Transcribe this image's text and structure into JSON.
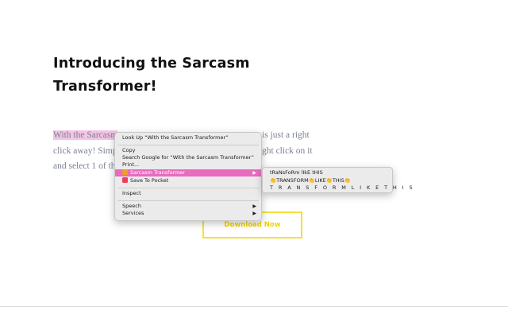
{
  "page": {
    "title_line1": "Introducing the Sarcasm",
    "title_line2": "Transformer!",
    "para_line1_highlight": "With the Sarcasm",
    "para_line1_end": "is just a right",
    "para_line2_start": "click away! Simpl",
    "para_line2_end": "ght click on it",
    "para_line3_start": "and select 1 of the",
    "download_button": "Download Now",
    "highlight_color": "#f3c4e3",
    "button_color": "#f4e03a"
  },
  "context_menu": {
    "look_up": "Look Up “With the Sarcasm Transformer”",
    "copy": "Copy",
    "search_google": "Search Google for “With the Sarcasm Transformer”",
    "print": "Print...",
    "sarcasm_transformer": "Sarcasm Transformer",
    "save_to_pocket": "Save To Pocket",
    "inspect": "Inspect",
    "speech": "Speech",
    "services": "Services",
    "submenu_arrow": "▶",
    "selected_color": "#e96bbd"
  },
  "submenu": {
    "option_1": "tRaNsFoRm lIkE tHIS",
    "option_2": "👏TRANSFORM👏LIKE👏THIS👏",
    "option_3": "T R A N S F O R M   L I K E   T H I S"
  }
}
